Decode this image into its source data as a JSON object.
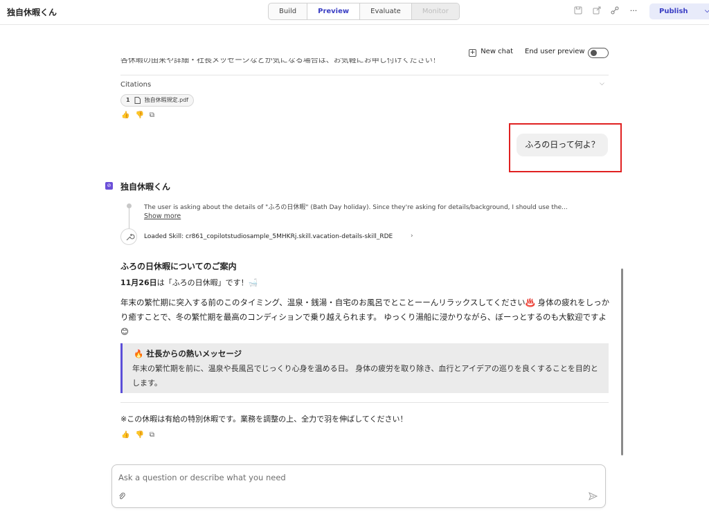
{
  "app": {
    "title": "独自休暇くん"
  },
  "tabs": [
    {
      "label": "Build"
    },
    {
      "label": "Preview"
    },
    {
      "label": "Evaluate"
    },
    {
      "label": "Monitor"
    }
  ],
  "toolbar": {
    "more": "···",
    "publish_label": "Publish"
  },
  "chat_header": {
    "new_chat_label": "New chat",
    "end_user_preview_label": "End user preview"
  },
  "prev_message": {
    "clipped_text": "各休暇の由来や詳細・社長メッセージなどが気になる場合は、お気軽にお申し付けください！",
    "citations_label": "Citations",
    "citation": {
      "number": "1",
      "file": "独自休暇規定.pdf"
    }
  },
  "user_message": {
    "text": "ふろの日って何よ？"
  },
  "bot": {
    "name": "独自休暇くん",
    "thought": "The user is asking about the details of \"ふろの日休暇\" (Bath Day holiday). Since they're asking for details/background, I should use the...",
    "show_more": "Show more",
    "skill": "Loaded Skill: cr861_copilotstudiosample_5MHKRj.skill.vacation-details-skill_RDE"
  },
  "response": {
    "heading": "ふろの日休暇についてのご案内",
    "date_bold": "11月26日",
    "date_rest": "は「ふろの日休暇」です！🛁",
    "paragraph": "年末の繁忙期に突入する前のこのタイミング、温泉・銭湯・自宅のお風呂でとことーーんリラックスしてください♨️ 身体の疲れをしっかり癒すことで、冬の繁忙期を最高のコンディションで乗り越えられます。 ゆっくり湯船に浸かりながら、ぼーっとするのも大歓迎ですよ😊",
    "quote_title": "🔥 社長からの熱いメッセージ",
    "quote_body": "年末の繁忙期を前に、温泉や長風呂でじっくり心身を温める日。 身体の疲労を取り除き、血行とアイデアの巡りを良くすることを目的とします。",
    "footnote": "※この休暇は有給の特別休暇です。業務を調整の上、全力で羽を伸ばしてください！"
  },
  "composer": {
    "placeholder": "Ask a question or describe what you need"
  },
  "colors": {
    "accent": "#3a3ec4",
    "highlight": "#e02020",
    "quote_border": "#5b4fd8",
    "bot_avatar": "#6b4fd8"
  }
}
